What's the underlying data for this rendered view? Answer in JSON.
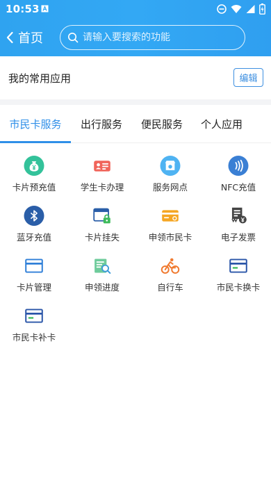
{
  "status": {
    "time": "10:53"
  },
  "nav": {
    "back_label": "首页",
    "search_placeholder": "请输入要搜索的功能"
  },
  "favorites": {
    "title": "我的常用应用",
    "edit_label": "编辑"
  },
  "tabs": [
    {
      "label": "市民卡服务",
      "active": true
    },
    {
      "label": "出行服务",
      "active": false
    },
    {
      "label": "便民服务",
      "active": false
    },
    {
      "label": "个人应用",
      "active": false
    }
  ],
  "services": [
    {
      "label": "卡片预充值",
      "icon": "money-bag-icon"
    },
    {
      "label": "学生卡办理",
      "icon": "student-card-icon"
    },
    {
      "label": "服务网点",
      "icon": "service-outlet-icon"
    },
    {
      "label": "NFC充值",
      "icon": "nfc-icon"
    },
    {
      "label": "蓝牙充值",
      "icon": "bluetooth-icon"
    },
    {
      "label": "卡片挂失",
      "icon": "card-lock-icon"
    },
    {
      "label": "申领市民卡",
      "icon": "card-apply-icon"
    },
    {
      "label": "电子发票",
      "icon": "e-invoice-icon"
    },
    {
      "label": "卡片管理",
      "icon": "card-manage-icon"
    },
    {
      "label": "申领进度",
      "icon": "apply-progress-icon"
    },
    {
      "label": "自行车",
      "icon": "bicycle-icon"
    },
    {
      "label": "市民卡换卡",
      "icon": "card-replace-icon"
    },
    {
      "label": "市民卡补卡",
      "icon": "card-reissue-icon"
    }
  ],
  "colors": {
    "header": "#33a8f4",
    "accent": "#2f8fe8"
  }
}
